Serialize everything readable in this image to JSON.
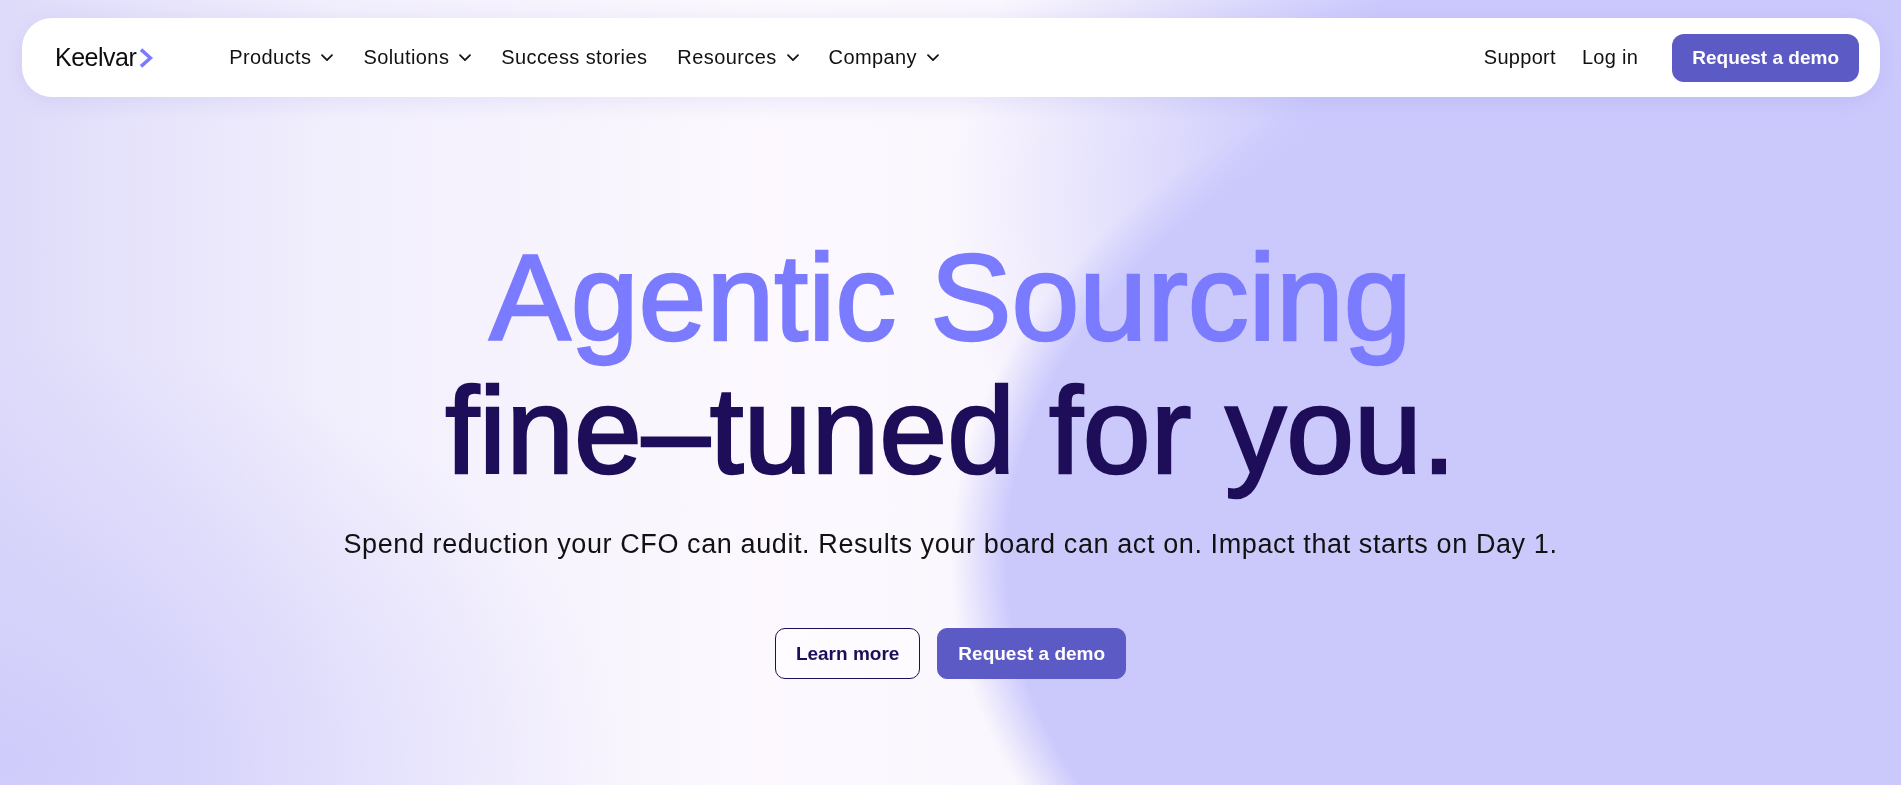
{
  "nav": {
    "logo": {
      "text": "Keelvar"
    },
    "items": [
      {
        "label": "Products",
        "dropdown": true
      },
      {
        "label": "Solutions",
        "dropdown": true
      },
      {
        "label": "Success stories",
        "dropdown": false
      },
      {
        "label": "Resources",
        "dropdown": true
      },
      {
        "label": "Company",
        "dropdown": true
      }
    ],
    "actions": [
      {
        "label": "Support",
        "kind": "link"
      },
      {
        "label": "Log in",
        "kind": "link"
      },
      {
        "label": "Request a demo",
        "kind": "primary"
      }
    ]
  },
  "hero": {
    "headline": {
      "accent": "Agentic Sourcing",
      "text": "fine–tuned for you."
    },
    "subtitle": "Spend reduction your CFO can audit. Results your board can act on. Impact that starts on Day 1.",
    "buttons": [
      {
        "label": "Learn more",
        "kind": "outline"
      },
      {
        "label": "Request a demo",
        "kind": "primary"
      }
    ]
  }
}
